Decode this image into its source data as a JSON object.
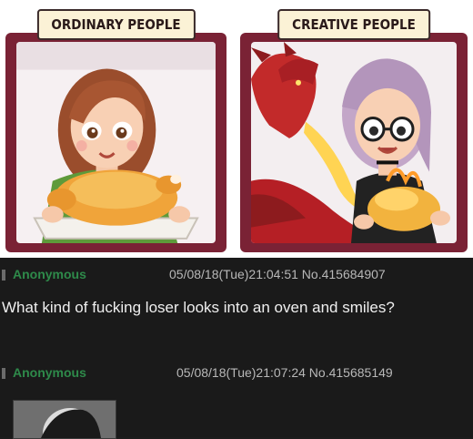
{
  "comic": {
    "left_caption": "ORDINARY PEOPLE",
    "right_caption": "CREATIVE PEOPLE"
  },
  "posts": [
    {
      "name": "Anonymous",
      "meta": "05/08/18(Tue)21:04:51 No.415684907",
      "text": "What kind of fucking loser looks into an oven and smiles?"
    },
    {
      "name": "Anonymous",
      "meta": "05/08/18(Tue)21:07:24 No.415685149",
      "text": ""
    }
  ],
  "icons": [
    "dragon-icon",
    "roast-chicken-icon",
    "avatar-thumbnail"
  ]
}
